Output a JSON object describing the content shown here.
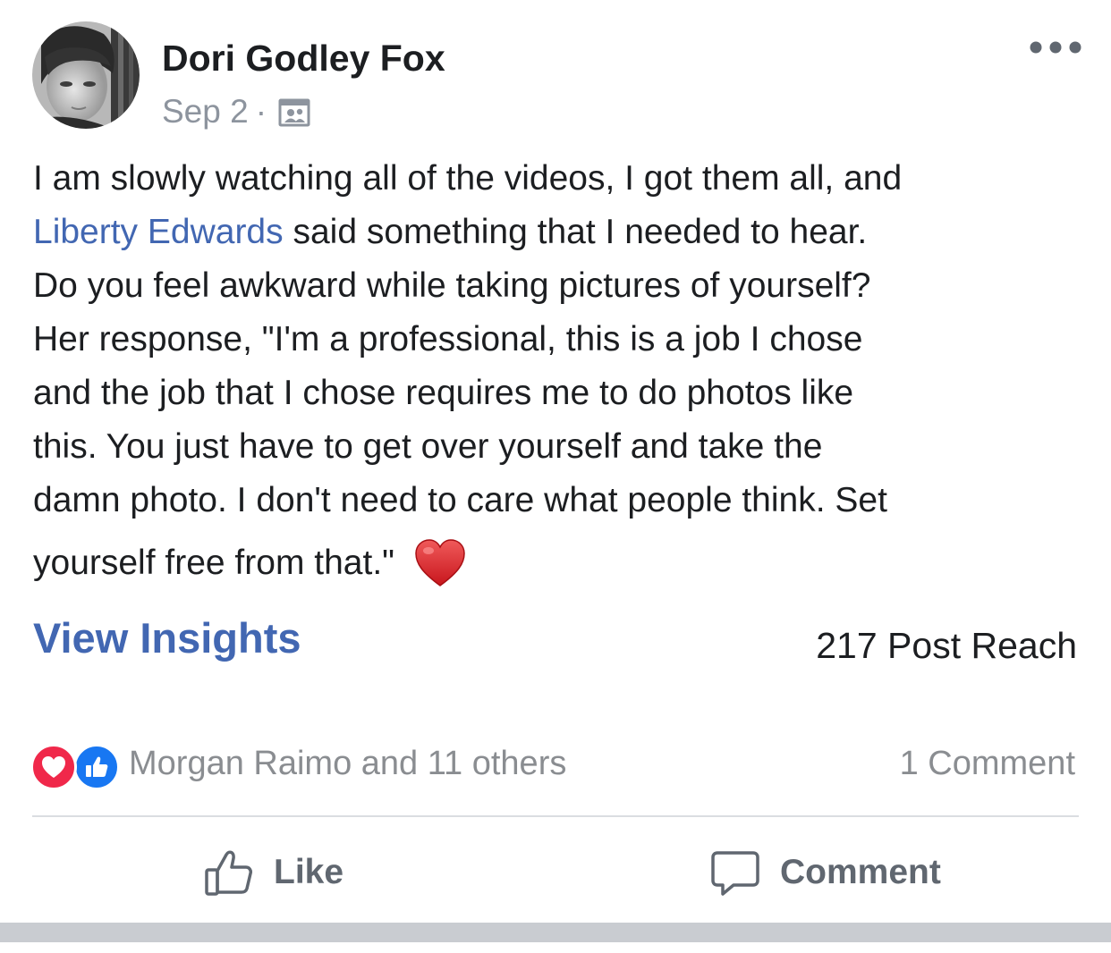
{
  "post": {
    "author": "Dori Godley Fox",
    "date": "Sep 2",
    "separator": "·",
    "privacy_icon": "group-privacy-icon",
    "more_icon": "more-horizontal-icon",
    "text_lines": [
      "I am slowly watching all of the videos, I got them all, and",
      "said something that I needed to hear.",
      "Do you feel awkward while taking pictures of yourself?",
      "Her response, \"I'm a professional, this is a job I chose",
      "and the job that I chose requires me to do photos like",
      "this. You just have to get over yourself and take the",
      "damn photo.  I don't need to care what people think.  Set",
      "yourself free from that.\""
    ],
    "mention": "Liberty Edwards",
    "emoji": "red-heart-emoji"
  },
  "insights": {
    "view_label": "View Insights",
    "reach_label": "217 Post Reach"
  },
  "engagement": {
    "reaction_icons": [
      "love-reaction-icon",
      "like-reaction-icon"
    ],
    "reactions_text": "Morgan Raimo and 11 others",
    "comments_text": "1 Comment"
  },
  "actions": {
    "like_label": "Like",
    "comment_label": "Comment"
  },
  "colors": {
    "link": "#4267b2",
    "text": "#1c1e21",
    "secondary": "#8a8d91",
    "action": "#606770",
    "love": "#f0284a",
    "like": "#1877f2"
  }
}
